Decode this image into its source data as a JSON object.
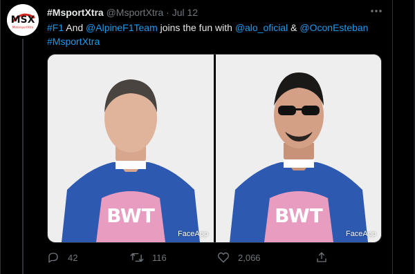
{
  "tweet": {
    "author_name": "#MsportXtra",
    "author_handle": "@MsportXtra",
    "separator": "·",
    "date": "Jul 12",
    "text_parts": [
      "#F1",
      " And ",
      "@AlpineF1Team",
      " joins the fun with ",
      "@alo_oficial",
      " & ",
      "@OconEsteban",
      "#MsportXtra"
    ],
    "media": {
      "watermark_left": "FaceApp",
      "watermark_right": "FaceApp",
      "suit_sponsor": "BWT"
    },
    "actions": {
      "replies": "42",
      "retweets": "116",
      "likes": "2,066"
    }
  },
  "avatar_text": {
    "logo": "MSX",
    "sub": "MotorsportXtra"
  },
  "colors": {
    "background": "#000000",
    "text": "#e7e9ea",
    "muted": "#71767b",
    "link": "#1d9bf0",
    "suit_blue": "#2d5ab0",
    "suit_pink": "#e89cc0"
  }
}
